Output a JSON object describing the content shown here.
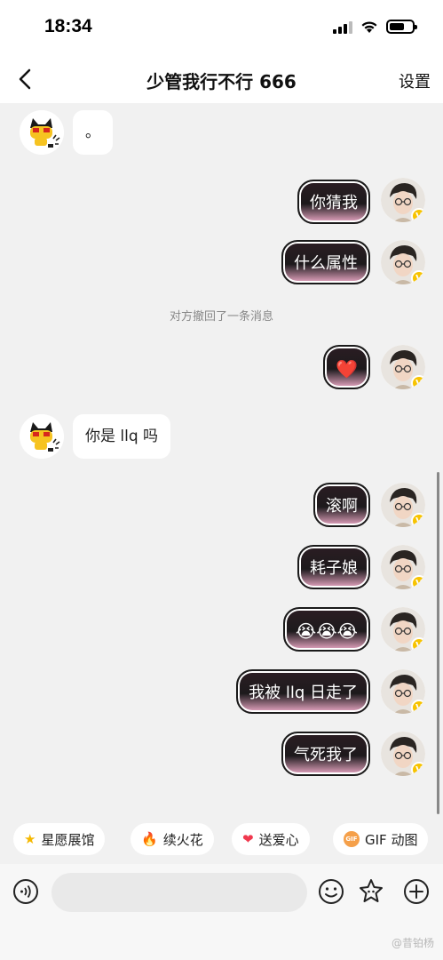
{
  "status_bar": {
    "time": "18:34"
  },
  "header": {
    "title": "少管我行不行 666",
    "settings_label": "设置"
  },
  "messages": [
    {
      "side": "them",
      "text": "。"
    },
    {
      "side": "me",
      "text": "你猜我"
    },
    {
      "side": "me",
      "text": "什么属性"
    },
    {
      "side": "system",
      "text": "对方撤回了一条消息"
    },
    {
      "side": "me",
      "text": "❤️"
    },
    {
      "side": "them",
      "text": "你是 llq 吗"
    },
    {
      "side": "me",
      "text": "滚啊"
    },
    {
      "side": "me",
      "text": "耗子娘"
    },
    {
      "side": "me",
      "text": "😭😭😭"
    },
    {
      "side": "me",
      "text": "我被 llq 日走了"
    },
    {
      "side": "me",
      "text": "气死我了"
    }
  ],
  "quick_actions": [
    {
      "icon": "star-icon",
      "label": "星愿展馆"
    },
    {
      "icon": "fire-icon",
      "label": "续火花"
    },
    {
      "icon": "heart-icon",
      "label": "送爱心"
    },
    {
      "icon": "gif-icon",
      "label": "GIF 动图"
    }
  ],
  "gif_badge": "GIF",
  "input": {
    "placeholder": ""
  },
  "watermark": "@昔铂杨",
  "colors": {
    "bubble_dark": "#1d1a1c",
    "bubble_pink": "#e9a7c3",
    "verified": "#f7c300"
  }
}
